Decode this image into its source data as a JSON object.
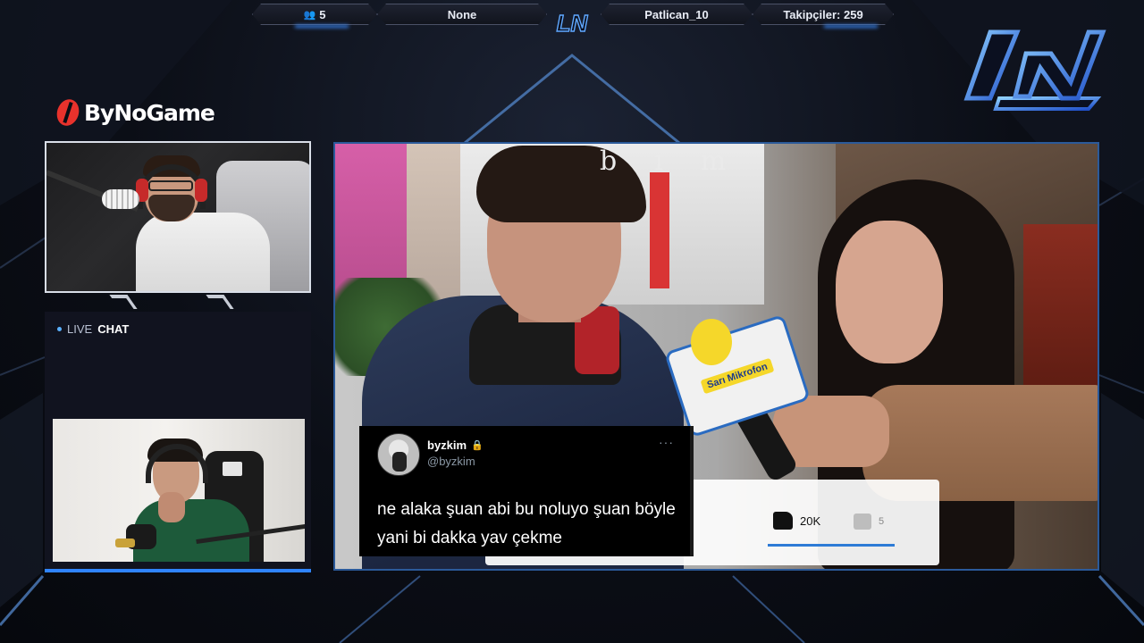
{
  "topbar": {
    "viewers": "5",
    "game": "None",
    "username": "Patlican_10",
    "followers": "Takipçiler: 259",
    "logo_text": "LN"
  },
  "sponsor": {
    "name": "ByNoGame"
  },
  "chat": {
    "live_label": "LIVE",
    "chat_label": "CHAT"
  },
  "video": {
    "overlay_text": "bim",
    "mic_label": "Sarı Mikrofon",
    "like_count": "20K",
    "dislike_count": "5"
  },
  "tweet": {
    "name": "byzkim",
    "handle": "@byzkim",
    "more": "···",
    "text": "ne alaka şuan abi bu noluyo şuan böyle yani bi dakka yav çekme"
  },
  "colors": {
    "accent": "#2f84ff",
    "background": "#0a0d14",
    "sponsor_red": "#e8322c"
  },
  "icons": {
    "viewers": "user-group-icon",
    "lock": "lock-icon",
    "like": "thumbs-up-icon",
    "dislike": "thumbs-down-icon"
  }
}
